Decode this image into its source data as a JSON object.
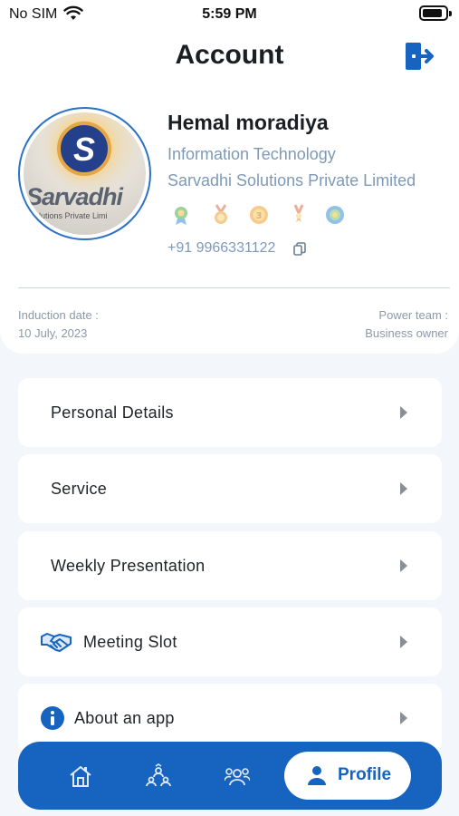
{
  "status_bar": {
    "carrier": "No SIM",
    "time": "5:59 PM"
  },
  "header": {
    "title": "Account"
  },
  "profile": {
    "name": "Hemal moradiya",
    "department": "Information Technology",
    "company": "Sarvadhi Solutions Private Limited",
    "phone": "+91 9966331122",
    "avatar_logo_letter": "S",
    "avatar_text": "Sarvadhi",
    "avatar_subtext": "Solutions Private Limi",
    "badges": [
      "badge-green-icon",
      "badge-medal-icon",
      "badge-coin-icon",
      "badge-ribbon-icon",
      "badge-emblem-icon"
    ]
  },
  "induction": {
    "label": "Induction date :",
    "value": "10 July, 2023"
  },
  "power_team": {
    "label": "Power team :",
    "value": "Business owner"
  },
  "menu": [
    {
      "label": "Personal Details",
      "icon": null
    },
    {
      "label": "Service",
      "icon": null
    },
    {
      "label": "Weekly Presentation",
      "icon": null
    },
    {
      "label": "Meeting Slot",
      "icon": "handshake-icon"
    },
    {
      "label": "About an app",
      "icon": "info-icon"
    }
  ],
  "bottom_nav": {
    "items": [
      "home-icon",
      "members-icon",
      "group-icon"
    ],
    "active_label": "Profile"
  },
  "colors": {
    "brand": "#1764c0",
    "muted_text": "#7d9ab8",
    "background": "#f3f6fb"
  }
}
